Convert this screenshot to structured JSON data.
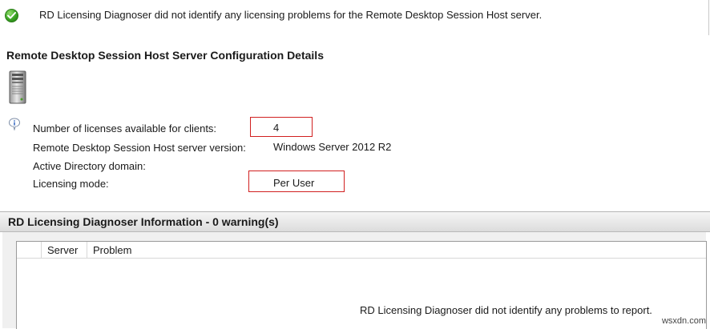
{
  "status": {
    "message": "RD Licensing Diagnoser did not identify any licensing problems for the Remote Desktop Session Host server."
  },
  "config": {
    "title": "Remote Desktop Session Host Server Configuration Details",
    "details": [
      {
        "label": "Number of licenses available for clients:",
        "value": "4",
        "highlighted": true
      },
      {
        "label": "Remote Desktop Session Host server version:",
        "value": "Windows Server 2012 R2",
        "highlighted": false
      },
      {
        "label": "Active Directory domain:",
        "value": "",
        "highlighted": false
      },
      {
        "label": "Licensing mode:",
        "value": "Per User",
        "highlighted": true
      }
    ]
  },
  "diagnoser": {
    "title": "RD Licensing Diagnoser Information - 0 warning(s)",
    "columns": [
      "Server",
      "Problem"
    ],
    "rows": [],
    "empty_message": "RD Licensing Diagnoser did not identify any problems to report."
  },
  "watermark": "wsxdn.com",
  "icons": {
    "status": "success-check-icon",
    "server": "server-tower-icon",
    "info": "info-icon"
  },
  "colors": {
    "highlight_border": "#d12020",
    "success_green": "#3aa324"
  }
}
